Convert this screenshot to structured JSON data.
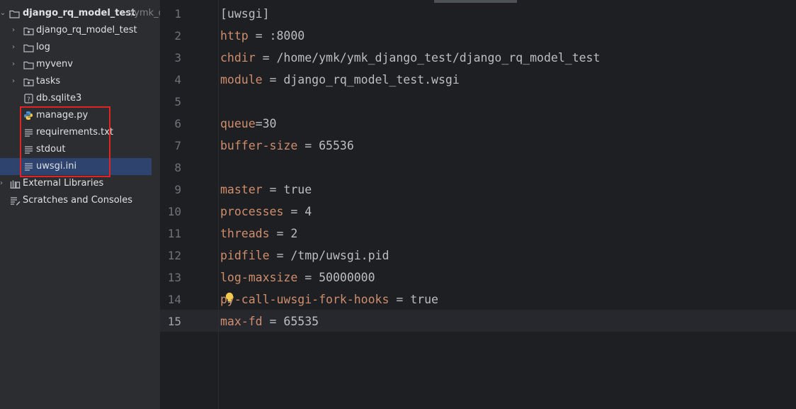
{
  "project": {
    "root_name": "django_rq_model_test",
    "root_path_hint": "~/ymk_d",
    "items": [
      {
        "label": "django_rq_model_test",
        "kind": "package"
      },
      {
        "label": "log",
        "kind": "folder"
      },
      {
        "label": "myvenv",
        "kind": "folder"
      },
      {
        "label": "tasks",
        "kind": "package"
      },
      {
        "label": "db.sqlite3",
        "kind": "unknown-file"
      },
      {
        "label": "manage.py",
        "kind": "python-file"
      },
      {
        "label": "requirements.txt",
        "kind": "text-file"
      },
      {
        "label": "stdout",
        "kind": "text-file"
      },
      {
        "label": "uwsgi.ini",
        "kind": "text-file"
      }
    ],
    "external_libraries": "External Libraries",
    "scratches": "Scratches and Consoles",
    "selected": "uwsgi.ini",
    "highlighted_items": [
      "manage.py",
      "requirements.txt",
      "stdout",
      "uwsgi.ini"
    ]
  },
  "editor": {
    "current_line": 15,
    "lines": [
      {
        "n": "1",
        "key": "",
        "rest": "[uwsgi]"
      },
      {
        "n": "2",
        "key": "http",
        "rest": " = :8000"
      },
      {
        "n": "3",
        "key": "chdir",
        "rest": " = /home/ymk/ymk_django_test/django_rq_model_test"
      },
      {
        "n": "4",
        "key": "module",
        "rest": " = django_rq_model_test.wsgi"
      },
      {
        "n": "5",
        "key": "",
        "rest": ""
      },
      {
        "n": "6",
        "key": "queue",
        "rest": "=30"
      },
      {
        "n": "7",
        "key": "buffer-size",
        "rest": " = 65536"
      },
      {
        "n": "8",
        "key": "",
        "rest": ""
      },
      {
        "n": "9",
        "key": "master",
        "rest": " = true"
      },
      {
        "n": "10",
        "key": "processes",
        "rest": " = 4"
      },
      {
        "n": "11",
        "key": "threads",
        "rest": " = 2"
      },
      {
        "n": "12",
        "key": "pidfile",
        "rest": " = /tmp/uwsgi.pid"
      },
      {
        "n": "13",
        "key": "log-maxsize",
        "rest": " = 50000000"
      },
      {
        "n": "14",
        "key": "py-call-uwsgi-fork-hooks",
        "rest": " = true"
      },
      {
        "n": "15",
        "key": "max-fd",
        "rest": " = 65535"
      }
    ]
  },
  "colors": {
    "key": "#cf8e6d",
    "text": "#bcbec4",
    "highlight_border": "#e02424",
    "selection": "#2e436e"
  }
}
